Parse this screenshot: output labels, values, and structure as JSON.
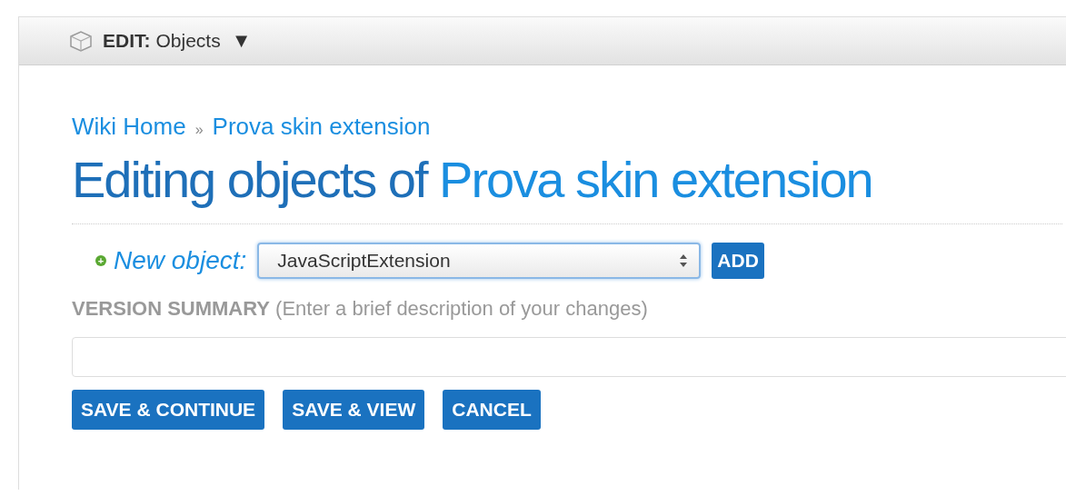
{
  "menu": {
    "label": "EDIT:",
    "value": "Objects",
    "arrow": "▼"
  },
  "breadcrumb": [
    {
      "label": "Wiki Home"
    },
    {
      "label": "Prova skin extension"
    }
  ],
  "breadcrumb_separator": "»",
  "title": {
    "text": "Editing objects of ",
    "link": "Prova skin extension"
  },
  "new_object": {
    "icon": "+",
    "label": "New object:",
    "value": "JavaScriptExtension",
    "button": "ADD"
  },
  "version_summary": {
    "label": "**VERSION SUMMARY** (Enter a brief description of your changes)"
  },
  "buttons": [
    "SAVE & CONTINUE",
    "SAVE & VIEW",
    "CANCEL"
  ]
}
